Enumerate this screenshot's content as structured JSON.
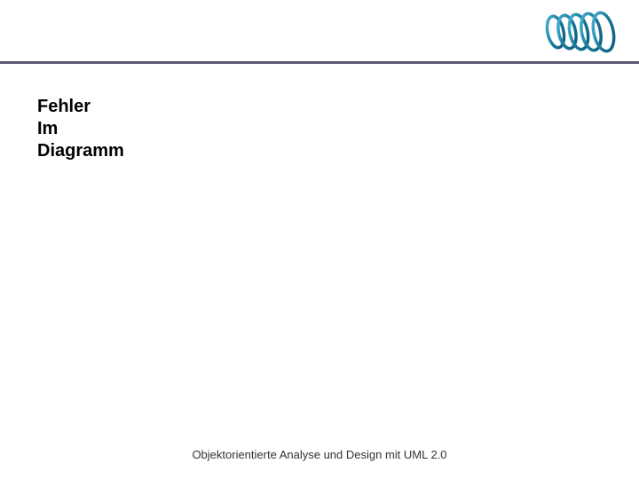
{
  "title": {
    "line1": "Fehler",
    "line2": "Im",
    "line3": "Diagramm"
  },
  "footer": "Objektorientierte Analyse und Design mit UML 2.0",
  "logo": {
    "name": "spring-coil-icon"
  }
}
